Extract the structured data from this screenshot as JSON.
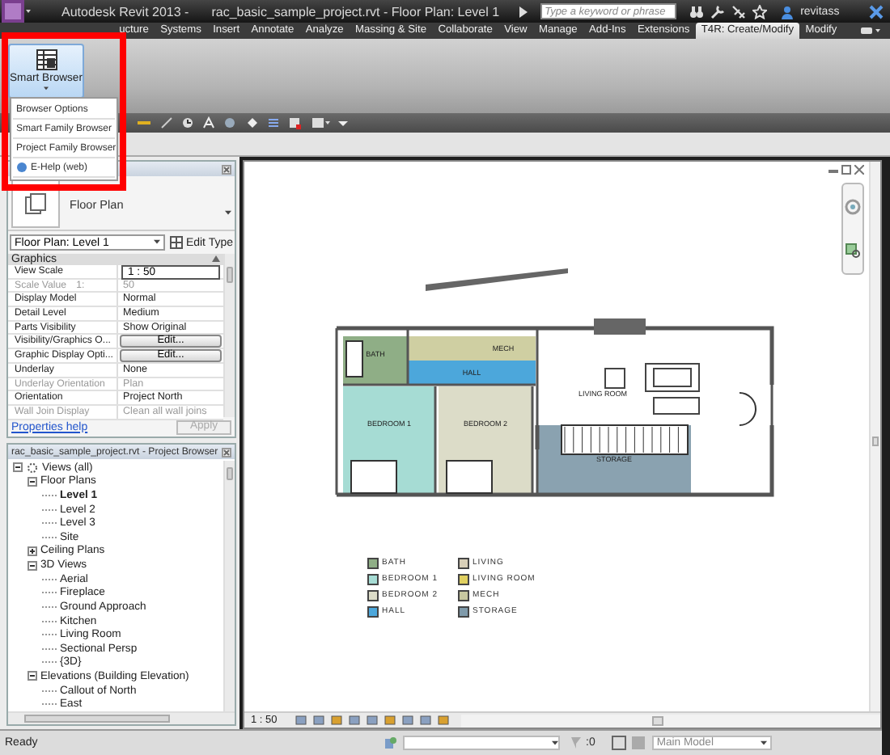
{
  "window": {
    "app_title": "Autodesk Revit 2013 -",
    "document_title": "rac_basic_sample_project.rvt - Floor Plan: Level 1"
  },
  "search": {
    "placeholder": "Type a keyword or phrase"
  },
  "user": {
    "name": "revitass"
  },
  "ribbon_tabs": [
    {
      "label": "ucture",
      "selected": false
    },
    {
      "label": "Systems",
      "selected": false
    },
    {
      "label": "Insert",
      "selected": false
    },
    {
      "label": "Annotate",
      "selected": false
    },
    {
      "label": "Analyze",
      "selected": false
    },
    {
      "label": "Massing & Site",
      "selected": false
    },
    {
      "label": "Collaborate",
      "selected": false
    },
    {
      "label": "View",
      "selected": false
    },
    {
      "label": "Manage",
      "selected": false
    },
    {
      "label": "Add-Ins",
      "selected": false
    },
    {
      "label": "Extensions",
      "selected": false
    },
    {
      "label": "T4R: Create/Modify",
      "selected": true
    },
    {
      "label": "Modify",
      "selected": false
    }
  ],
  "smart_browser": {
    "label": "Smart Browser",
    "menu": [
      {
        "label": "Browser Options",
        "kind": "plain"
      },
      {
        "label": "Smart Family Browser",
        "kind": "plain"
      },
      {
        "label": "Project Family Browser",
        "kind": "plain"
      },
      {
        "label": "E-Help (web)",
        "kind": "help"
      }
    ]
  },
  "properties": {
    "type_name": "Floor Plan",
    "view_selector": "Floor Plan: Level 1",
    "edit_type": "Edit Type",
    "section": "Graphics",
    "rows": [
      {
        "name": "View Scale",
        "value": "1 : 50",
        "kind": "field",
        "disabled": false
      },
      {
        "name": "Scale Value",
        "unit": "1:",
        "value": "50",
        "kind": "text",
        "disabled": true
      },
      {
        "name": "Display Model",
        "value": "Normal",
        "kind": "text",
        "disabled": false
      },
      {
        "name": "Detail Level",
        "value": "Medium",
        "kind": "text",
        "disabled": false
      },
      {
        "name": "Parts Visibility",
        "value": "Show Original",
        "kind": "text",
        "disabled": false
      },
      {
        "name": "Visibility/Graphics O...",
        "value": "Edit...",
        "kind": "button",
        "disabled": false
      },
      {
        "name": "Graphic Display Opti...",
        "value": "Edit...",
        "kind": "button",
        "disabled": false
      },
      {
        "name": "Underlay",
        "value": "None",
        "kind": "text",
        "disabled": false
      },
      {
        "name": "Underlay Orientation",
        "value": "Plan",
        "kind": "text",
        "disabled": true
      },
      {
        "name": "Orientation",
        "value": "Project North",
        "kind": "text",
        "disabled": false
      },
      {
        "name": "Wall Join Display",
        "value": "Clean all wall joins",
        "kind": "text",
        "disabled": true
      }
    ],
    "help_link": "Properties help",
    "apply": {
      "label": "Apply",
      "disabled": true
    }
  },
  "project_browser": {
    "title": "rac_basic_sample_project.rvt - Project Browser",
    "tree": [
      {
        "label": "Views (all)",
        "expanded": true,
        "selected": false,
        "children": [
          {
            "label": "Floor Plans",
            "expanded": true,
            "selected": false,
            "children": [
              {
                "label": "Level 1",
                "selected": true
              },
              {
                "label": "Level 2",
                "selected": false
              },
              {
                "label": "Level 3",
                "selected": false
              },
              {
                "label": "Site",
                "selected": false
              }
            ]
          },
          {
            "label": "Ceiling Plans",
            "expanded": false,
            "selected": false
          },
          {
            "label": "3D Views",
            "expanded": true,
            "selected": false,
            "children": [
              {
                "label": "Aerial",
                "selected": false
              },
              {
                "label": "Fireplace",
                "selected": false
              },
              {
                "label": "Ground Approach",
                "selected": false
              },
              {
                "label": "Kitchen",
                "selected": false
              },
              {
                "label": "Living Room",
                "selected": false
              },
              {
                "label": "Sectional Persp",
                "selected": false
              },
              {
                "label": "{3D}",
                "selected": false
              }
            ]
          },
          {
            "label": "Elevations (Building Elevation)",
            "expanded": true,
            "selected": false,
            "children": [
              {
                "label": "Callout of North",
                "selected": false
              },
              {
                "label": "East",
                "selected": false
              }
            ]
          }
        ]
      }
    ]
  },
  "floor_plan": {
    "rooms": [
      {
        "label": "BATH",
        "color": "#8fae86"
      },
      {
        "label": "MECH",
        "color": "#cfcfa2"
      },
      {
        "label": "HALL",
        "color": "#4ca7db"
      },
      {
        "label": "LIVING ROOM",
        "color": "#ffffff"
      },
      {
        "label": "BEDROOM 1",
        "color": "#a6dcd4"
      },
      {
        "label": "BEDROOM 2",
        "color": "#dcdcc8"
      },
      {
        "label": "STORAGE",
        "color": "#8aa2b0"
      }
    ]
  },
  "legend": [
    {
      "label": "BATH",
      "color": "#8fae86"
    },
    {
      "label": "BEDROOM 1",
      "color": "#a6dcd4"
    },
    {
      "label": "BEDROOM 2",
      "color": "#dcdcc8"
    },
    {
      "label": "HALL",
      "color": "#4ca7db"
    },
    {
      "label": "LIVING",
      "color": "#d8cfb8"
    },
    {
      "label": "LIVING ROOM",
      "color": "#e0d060"
    },
    {
      "label": "MECH",
      "color": "#c8c8a0"
    },
    {
      "label": "STORAGE",
      "color": "#7f9aaa"
    }
  ],
  "view_bar": {
    "scale": "1 : 50"
  },
  "status_bar": {
    "text": "Ready",
    "count": ":0",
    "model": "Main Model"
  }
}
